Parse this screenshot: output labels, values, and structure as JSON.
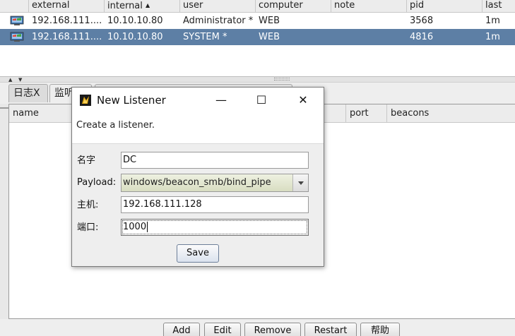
{
  "beacons": {
    "columns": [
      "external",
      "internal",
      "user",
      "computer",
      "note",
      "pid",
      "last"
    ],
    "sort_indicator": "▲",
    "rows": [
      {
        "external": "192.168.111....",
        "internal": "10.10.10.80",
        "user": "Administrator *",
        "computer": "WEB",
        "note": "",
        "pid": "3568",
        "last": "1m",
        "selected": false
      },
      {
        "external": "192.168.111....",
        "internal": "10.10.10.80",
        "user": "SYSTEM *",
        "computer": "WEB",
        "note": "",
        "pid": "4816",
        "last": "1m",
        "selected": true
      }
    ]
  },
  "tabs": [
    {
      "label": "日志X",
      "active": false
    },
    {
      "label": "监听",
      "active": true
    }
  ],
  "listeners": {
    "columns": [
      "name",
      "port",
      "beacons"
    ]
  },
  "bottom_buttons": [
    "Add",
    "Edit",
    "Remove",
    "Restart",
    "帮助"
  ],
  "dialog": {
    "title": "New Listener",
    "description": "Create a listener.",
    "icon": "cobalt-strike-app-icon",
    "fields": {
      "name_label": "名字",
      "name_value": "DC",
      "payload_label": "Payload:",
      "payload_value": "windows/beacon_smb/bind_pipe",
      "host_label": "主机:",
      "host_value": "192.168.111.128",
      "port_label": "端口:",
      "port_value": "1000"
    },
    "save_label": "Save",
    "window_buttons": {
      "minimize": "—",
      "maximize": "☐",
      "close": "✕"
    }
  },
  "colors": {
    "selected_row": "#5d7fa5",
    "payload_bg": "#dfe3c8"
  }
}
